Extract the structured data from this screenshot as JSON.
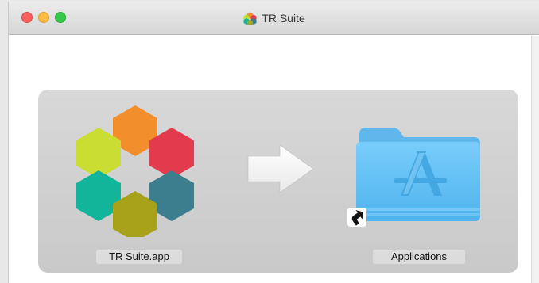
{
  "window": {
    "title": "TR Suite",
    "title_icon": "tr-suite-app-icon"
  },
  "installer": {
    "app": {
      "label": "TR Suite.app",
      "icon": "hexagon-ring-app-icon"
    },
    "arrow": {
      "icon": "right-arrow-icon"
    },
    "destination": {
      "label": "Applications",
      "icon": "applications-folder-icon",
      "badge": "alias-arrow-icon"
    }
  },
  "colors": {
    "hex_orange": "#f28f2c",
    "hex_red": "#e23b4e",
    "hex_teal_dark": "#3c7e8d",
    "hex_olive": "#a8a21b",
    "hex_teal": "#12b49a",
    "hex_lime": "#c9dd32",
    "folder_blue": "#6cc3f7"
  }
}
